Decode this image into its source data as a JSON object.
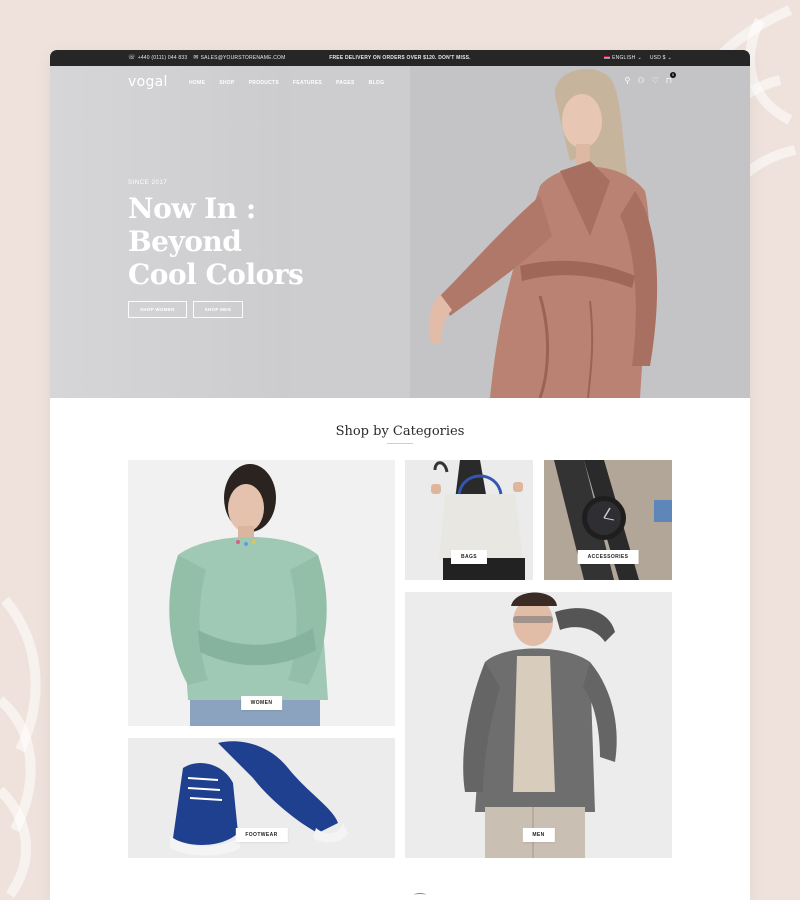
{
  "topbar": {
    "phone": "+440 (0111) 044 833",
    "email": "SALES@YOURSTORENAME.COM",
    "promo": "FREE DELIVERY ON ORDERS OVER $120. DON'T MISS.",
    "language": "ENGLISH",
    "currency": "USD $"
  },
  "nav": {
    "logo": "vogal",
    "items": [
      "HOME",
      "SHOP",
      "PRODUCTS",
      "FEATURES",
      "PAGES",
      "BLOG"
    ],
    "cart_count": "0",
    "icons": [
      "search-icon",
      "user-icon",
      "heart-icon",
      "cart-icon"
    ]
  },
  "hero": {
    "since": "SINCE 2017",
    "headline_line1": "Now In : Beyond",
    "headline_line2": "Cool Colors",
    "button_women": "SHOP WOMEN",
    "button_men": "SHOP MEN"
  },
  "categories": {
    "title": "Shop by Categories",
    "items": [
      {
        "label": "WOMEN"
      },
      {
        "label": "BAGS"
      },
      {
        "label": "ACCESSORIES"
      },
      {
        "label": "MEN"
      },
      {
        "label": "FOOTWEAR"
      }
    ]
  },
  "colors": {
    "page_bg": "#efe2dc",
    "topbar": "#262626",
    "coat": "#b98272",
    "sweater": "#9fc9b5",
    "shoe": "#1f3f8f",
    "suit": "#6e6e6e"
  }
}
